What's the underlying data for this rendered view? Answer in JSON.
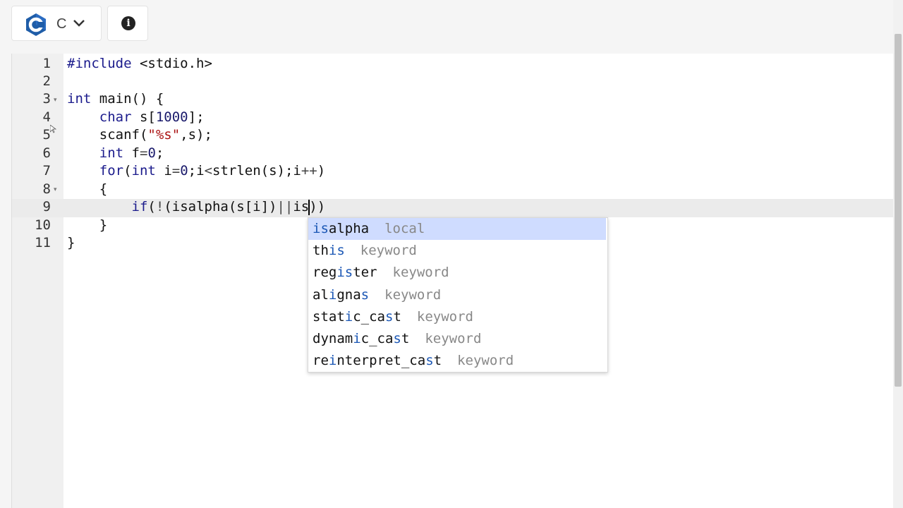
{
  "toolbar": {
    "language": "C",
    "brand_color": "#1f5da8",
    "icons": [
      "c-language-logo-icon",
      "chevron-down-icon",
      "info-icon"
    ]
  },
  "editor": {
    "line_numbers": [
      "1",
      "2",
      "3",
      "4",
      "5",
      "6",
      "7",
      "8",
      "9",
      "10",
      "11"
    ],
    "fold_lines": [
      "3",
      "8"
    ],
    "active_line": "9",
    "lines": [
      "#include <stdio.h>",
      "",
      "int main() {",
      "    char s[1000];",
      "    scanf(\"%s\",s);",
      "    int f=0;",
      "    for(int i=0;i<strlen(s);i++)",
      "    {",
      "        if(!(isalpha(s[i])||is))",
      "    }",
      "}"
    ]
  },
  "autocomplete": {
    "typed": "is",
    "items": [
      {
        "word": "isalpha",
        "meta": "local",
        "selected": true
      },
      {
        "word": "this",
        "meta": "keyword",
        "selected": false
      },
      {
        "word": "register",
        "meta": "keyword",
        "selected": false
      },
      {
        "word": "alignas",
        "meta": "keyword",
        "selected": false
      },
      {
        "word": "static_cast",
        "meta": "keyword",
        "selected": false
      },
      {
        "word": "dynamic_cast",
        "meta": "keyword",
        "selected": false
      },
      {
        "word": "reinterpret_cast",
        "meta": "keyword",
        "selected": false
      }
    ]
  }
}
